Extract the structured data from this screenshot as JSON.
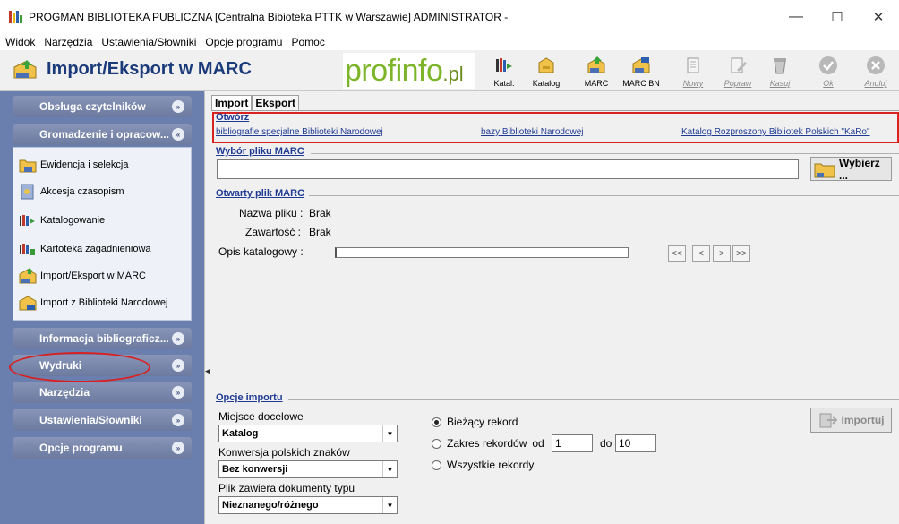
{
  "window": {
    "title": "PROGMAN BIBLIOTEKA PUBLICZNA [Centralna Bibioteka PTTK w Warszawie] ADMINISTRATOR -",
    "minimize": "—",
    "maximize": "☐",
    "close": "✕"
  },
  "menu": {
    "items": [
      "Widok",
      "Narzędzia",
      "Ustawienia/Słowniki",
      "Opcje programu",
      "Pomoc"
    ]
  },
  "toolbar": {
    "heading": "Import/Eksport w MARC",
    "logo_main": "profinfo",
    "logo_suffix": ".pl",
    "buttons": [
      {
        "label": "Katal.",
        "icon": "catalog-books-icon"
      },
      {
        "label": "Katalog",
        "icon": "catalog-drawer-icon"
      },
      {
        "label": "MARC",
        "icon": "marc-icon"
      },
      {
        "label": "MARC BN",
        "icon": "marc-bn-icon"
      },
      {
        "label": "Nowy",
        "icon": "new-document-icon"
      },
      {
        "label": "Popraw",
        "icon": "edit-document-icon"
      },
      {
        "label": "Kasuj",
        "icon": "trash-icon"
      },
      {
        "label": "Ok",
        "icon": "check-icon"
      },
      {
        "label": "Anuluj",
        "icon": "cancel-icon"
      }
    ]
  },
  "sidebar": {
    "groups": [
      {
        "label": "Obsługa czytelników",
        "chevron": "»"
      },
      {
        "label": "Gromadzenie i opracow...",
        "chevron": "«"
      },
      {
        "label": "Informacja bibliograficz...",
        "chevron": "»"
      },
      {
        "label": "Wydruki",
        "chevron": "»"
      },
      {
        "label": "Narzędzia",
        "chevron": "»"
      },
      {
        "label": "Ustawienia/Słowniki",
        "chevron": "»"
      },
      {
        "label": "Opcje programu",
        "chevron": "»"
      }
    ],
    "items": [
      {
        "label": "Ewidencja i selekcja",
        "icon": "folder-icon"
      },
      {
        "label": "Akcesja czasopism",
        "icon": "journal-icon"
      },
      {
        "label": "Katalogowanie",
        "icon": "books-icon"
      },
      {
        "label": "Kartoteka zagadnieniowa",
        "icon": "books-z-icon"
      },
      {
        "label": "Import/Eksport w MARC",
        "icon": "marc-import-icon"
      },
      {
        "label": "Import z Biblioteki Narodowej",
        "icon": "bn-import-icon"
      }
    ]
  },
  "tabs": [
    "Import",
    "Eksport"
  ],
  "open": {
    "title": "Otwórz",
    "links": [
      "bibliografie specjalne Biblioteki Narodowej",
      "bazy Biblioteki Narodowej",
      "Katalog Rozproszony Bibliotek Polskich \"KaRo\""
    ]
  },
  "file_select": {
    "title": "Wybór pliku MARC",
    "value": "",
    "button": "Wybierz ..."
  },
  "opened_file": {
    "title": "Otwarty plik MARC",
    "name_label": "Nazwa pliku :",
    "name_value": "Brak",
    "content_label": "Zawartość :",
    "content_value": "Brak",
    "description_label": "Opis katalogowy :",
    "nav": [
      "<<",
      "<",
      ">",
      ">>"
    ]
  },
  "import_options": {
    "title": "Opcje importu",
    "destination_label": "Miejsce docelowe",
    "destination_value": "Katalog",
    "conversion_label": "Konwersja polskich znaków",
    "conversion_value": "Bez konwersji",
    "doctype_label": "Plik zawiera dokumenty typu",
    "doctype_value": "Nieznanego/różnego",
    "radio_current": "Bieżący rekord",
    "radio_range": "Zakres rekordów",
    "from_label": "od",
    "from_value": "1",
    "to_label": "do",
    "to_value": "10",
    "radio_all": "Wszystkie rekordy",
    "selected": "current",
    "import_button": "Importuj"
  }
}
